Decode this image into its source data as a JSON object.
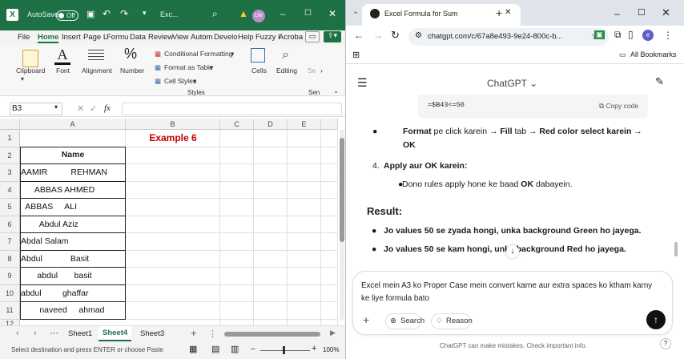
{
  "excel": {
    "autosave_label": "AutoSave",
    "autosave_state": "Off",
    "file_name": "Exc...",
    "avatar": "LW",
    "tabs": [
      "File",
      "Home",
      "Insert",
      "Page L",
      "Formu",
      "Data",
      "Review",
      "View",
      "Autom",
      "Develo",
      "Help",
      "Fuzzy I",
      "Acroba"
    ],
    "ribbon": {
      "clipboard": "Clipboard",
      "font": "Font",
      "alignment": "Alignment",
      "number": "Number",
      "cond_fmt": "Conditional Formatting",
      "fmt_table": "Format as Table",
      "cell_styles": "Cell Styles",
      "styles": "Styles",
      "cells": "Cells",
      "editing": "Editing",
      "se": "Se",
      "sen": "Sen"
    },
    "name_box": "B3",
    "fx": "fx",
    "columns": [
      "A",
      "B",
      "C",
      "D",
      "E"
    ],
    "rows": [
      "1",
      "2",
      "3",
      "4",
      "5",
      "6",
      "7",
      "8",
      "9",
      "10",
      "11",
      "12"
    ],
    "title": "Example 6",
    "header": "Name",
    "names": [
      "AAMIR          REHMAN",
      "      ABBAS AHMED",
      "  ABBAS     ALI",
      "        Abdul Aziz",
      "Abdal Salam",
      "Abdul            Basit",
      "       abdul       basit",
      "abdul         ghaffar",
      "        naveed     ahmad"
    ],
    "sheets": [
      "Sheet1",
      "Sheet4",
      "Sheet3"
    ],
    "status_text": "Select destination and press ENTER or choose Paste",
    "zoom": "100%"
  },
  "colors": {
    "excel_green": "#1e7145",
    "red_title": "#c00000",
    "chrome_tab_bg": "#dfe3ea"
  },
  "chrome": {
    "tab_title": "Excel Formula for Sum",
    "url": "chatgpt.com/c/67a8e493-9e24-800c-b...",
    "all_bookmarks": "All Bookmarks",
    "profile": "e"
  },
  "chatgpt": {
    "header": "ChatGPT",
    "code_text": "=$B43<=50",
    "copy_code": "Copy code",
    "b1_bold1": "Format",
    "b1_mid": " pe click karein → ",
    "b1_fill": "Fill",
    "b1_tab": " tab → ",
    "b1_red": "Red color select karein →",
    "b1_ok": "OK",
    "step4_num": "4.",
    "step4": "Apply aur OK karein:",
    "step4_sub_a": "Dono rules apply hone ke baad ",
    "step4_sub_ok": "OK",
    "step4_sub_b": " dabayein.",
    "result": "Result:",
    "r1": "Jo values 50 se zyada hongi, unka background Green ho jayega.",
    "r2": "Jo values 50 se kam hongi, unka background Red ho jayega.",
    "composer_text": "Excel mein A3 ko Proper Case mein convert karne aur extra spaces ko ktham karny ke liye formula bato",
    "search": "Search",
    "reason": "Reason",
    "footer": "ChatGPT can make mistakes. Check important info."
  }
}
